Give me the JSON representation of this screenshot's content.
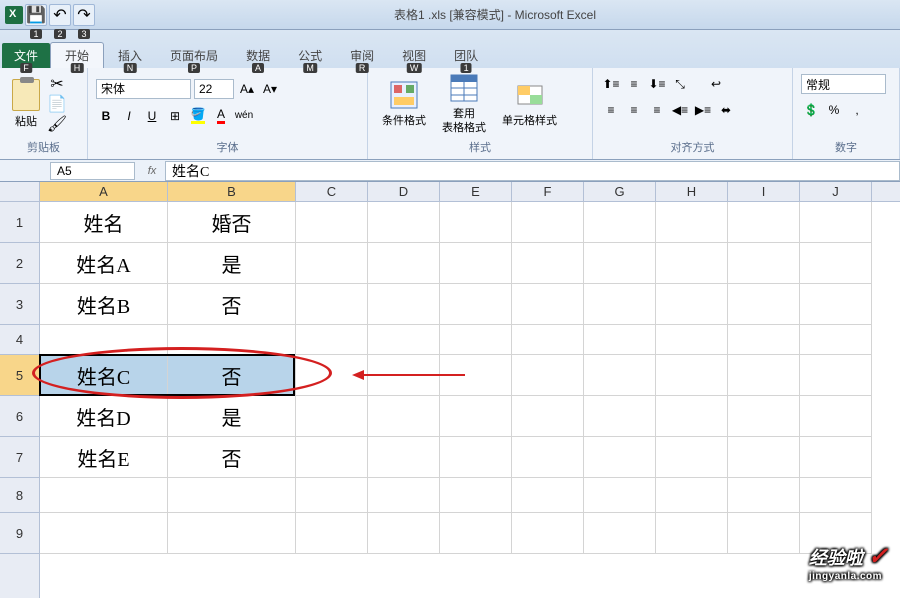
{
  "window": {
    "title": "表格1 .xls  [兼容模式] - Microsoft Excel"
  },
  "qat": {
    "keys": [
      "1",
      "2",
      "3"
    ]
  },
  "tabs": {
    "file": "文件",
    "file_key": "F",
    "home": "开始",
    "home_key": "H",
    "insert": "插入",
    "insert_key": "N",
    "layout": "页面布局",
    "layout_key": "P",
    "data": "数据",
    "data_key": "A",
    "formulas": "公式",
    "formulas_key": "M",
    "review": "审阅",
    "review_key": "R",
    "view": "视图",
    "view_key": "W",
    "team": "团队",
    "team_key": "1"
  },
  "ribbon": {
    "clipboard": {
      "label": "剪贴板",
      "paste": "粘贴"
    },
    "font": {
      "label": "字体",
      "name": "宋体",
      "size": "22",
      "bold": "B",
      "italic": "I",
      "underline": "U"
    },
    "styles": {
      "label": "样式",
      "conditional": "条件格式",
      "table": "套用",
      "table2": "表格格式",
      "cell": "单元格样式"
    },
    "align": {
      "label": "对齐方式"
    },
    "number": {
      "label": "数字",
      "general": "常规",
      "percent": "%",
      "comma": ","
    }
  },
  "namebox": "A5",
  "formula": "姓名C",
  "columns": [
    "A",
    "B",
    "C",
    "D",
    "E",
    "F",
    "G",
    "H",
    "I",
    "J"
  ],
  "rows": [
    "1",
    "2",
    "3",
    "4",
    "5",
    "6",
    "7",
    "8",
    "9"
  ],
  "cells": {
    "r1": {
      "a": "姓名",
      "b": "婚否"
    },
    "r2": {
      "a": "姓名A",
      "b": "是"
    },
    "r3": {
      "a": "姓名B",
      "b": "否"
    },
    "r4": {
      "a": "",
      "b": ""
    },
    "r5": {
      "a": "姓名C",
      "b": "否"
    },
    "r6": {
      "a": "姓名D",
      "b": "是"
    },
    "r7": {
      "a": "姓名E",
      "b": "否"
    }
  },
  "watermark": {
    "text": "经验啦",
    "url": "jingyanla.com"
  }
}
